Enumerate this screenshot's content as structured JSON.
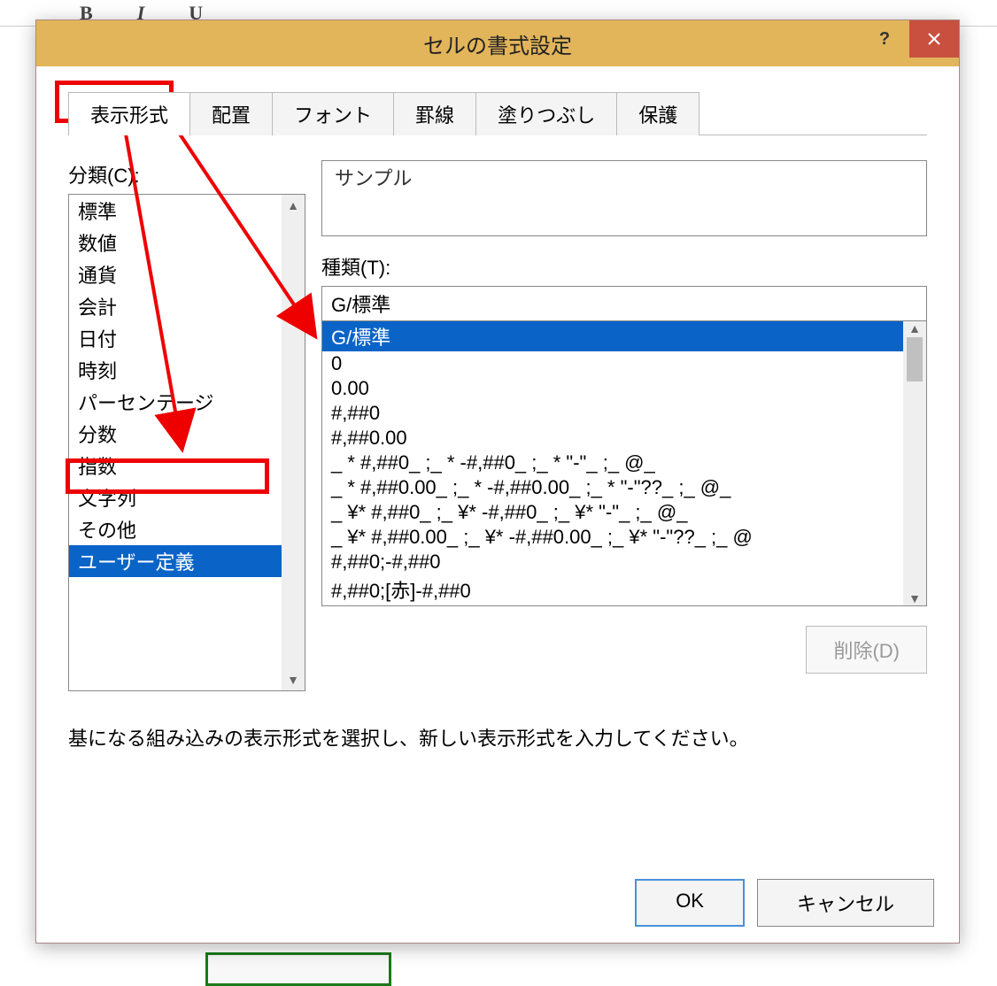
{
  "dialog": {
    "title": "セルの書式設定",
    "help": "?",
    "tabs": [
      "表示形式",
      "配置",
      "フォント",
      "罫線",
      "塗りつぶし",
      "保護"
    ],
    "category_label": "分類(C):",
    "categories": [
      "標準",
      "数値",
      "通貨",
      "会計",
      "日付",
      "時刻",
      "パーセンテージ",
      "分数",
      "指数",
      "文字列",
      "その他",
      "ユーザー定義"
    ],
    "selected_category_index": 11,
    "sample_label": "サンプル",
    "type_label": "種類(T):",
    "type_value": "G/標準",
    "type_list": [
      "G/標準",
      "0",
      "0.00",
      "#,##0",
      "#,##0.00",
      "_ * #,##0_ ;_ * -#,##0_ ;_ * \"-\"_ ;_ @_",
      "_ * #,##0.00_ ;_ * -#,##0.00_ ;_ * \"-\"??_ ;_ @_",
      "_ ¥* #,##0_ ;_ ¥* -#,##0_ ;_ ¥* \"-\"_ ;_ @_",
      "_ ¥* #,##0.00_ ;_ ¥* -#,##0.00_ ;_ ¥* \"-\"??_ ;_ @",
      "#,##0;-#,##0",
      "#,##0;[赤]-#,##0"
    ],
    "selected_type_index": 0,
    "delete_label": "削除(D)",
    "hint": "基になる組み込みの表示形式を選択し、新しい表示形式を入力してください。",
    "ok": "OK",
    "cancel": "キャンセル"
  },
  "ribbon": {
    "b": "B",
    "i": "I",
    "u": "U"
  }
}
